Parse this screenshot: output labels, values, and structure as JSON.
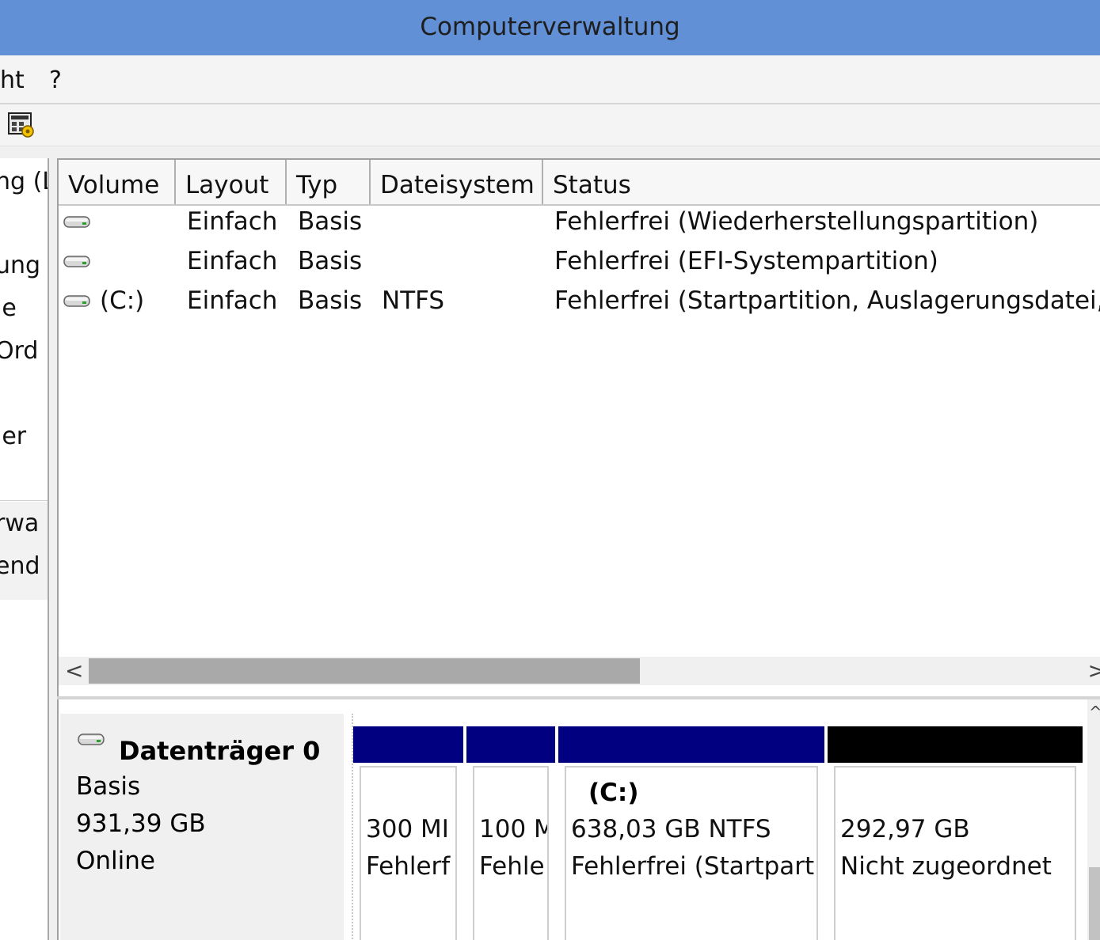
{
  "window": {
    "title": "Computerverwaltung"
  },
  "menu": {
    "items": [
      "ht",
      "?"
    ]
  },
  "toolbar": {
    "icon": "properties-icon"
  },
  "tree": {
    "items": [
      "ng (L",
      "ung",
      "je",
      "Ord",
      "jer",
      "rwa",
      "end"
    ]
  },
  "volume_list": {
    "columns": [
      "Volume",
      "Layout",
      "Typ",
      "Dateisystem",
      "Status"
    ],
    "rows": [
      {
        "volume": "",
        "layout": "Einfach",
        "typ": "Basis",
        "dateisystem": "",
        "status": "Fehlerfrei (Wiederherstellungspartition)"
      },
      {
        "volume": "",
        "layout": "Einfach",
        "typ": "Basis",
        "dateisystem": "",
        "status": "Fehlerfrei (EFI-Systempartition)"
      },
      {
        "volume": "(C:)",
        "layout": "Einfach",
        "typ": "Basis",
        "dateisystem": "NTFS",
        "status": "Fehlerfrei (Startpartition, Auslagerungsdatei,"
      }
    ],
    "scroll_left": "<",
    "scroll_right": ">"
  },
  "disk": {
    "name": "Datenträger 0",
    "type": "Basis",
    "size": "931,39 GB",
    "state": "Online",
    "partitions": [
      {
        "label": "",
        "line1": "300 MI",
        "line2": "Fehlerf",
        "bar_color": "#000080"
      },
      {
        "label": "",
        "line1": "100 M",
        "line2": "Fehle",
        "bar_color": "#000080"
      },
      {
        "label": "(C:)",
        "line1": "638,03 GB NTFS",
        "line2": "Fehlerfrei (Startpart",
        "bar_color": "#000080"
      },
      {
        "label": "",
        "line1": "292,97 GB",
        "line2": "Nicht zugeordnet",
        "bar_color": "#000000"
      }
    ]
  },
  "colors": {
    "titlebar": "#6190d6",
    "primary_partition": "#000080",
    "unallocated": "#000000"
  }
}
